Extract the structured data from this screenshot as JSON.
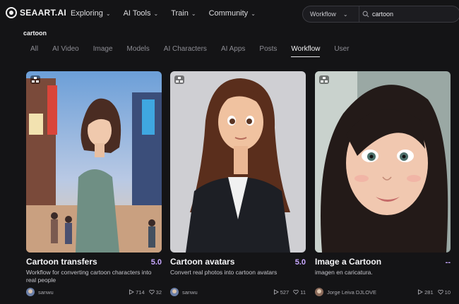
{
  "logo": {
    "text": "SEAART.AI"
  },
  "nav": [
    {
      "label": "Exploring"
    },
    {
      "label": "AI Tools"
    },
    {
      "label": "Train"
    },
    {
      "label": "Community"
    }
  ],
  "search": {
    "scope": "Workflow",
    "value": "cartoon",
    "placeholder": ""
  },
  "query_label": "cartoon",
  "tabs": [
    {
      "label": "All"
    },
    {
      "label": "AI Video"
    },
    {
      "label": "Image"
    },
    {
      "label": "Models"
    },
    {
      "label": "AI Characters"
    },
    {
      "label": "AI Apps"
    },
    {
      "label": "Posts"
    },
    {
      "label": "Workflow",
      "active": true
    },
    {
      "label": "User"
    }
  ],
  "cards": [
    {
      "title": "Cartoon transfers",
      "score": "5.0",
      "description": "Workflow for converting cartoon characters into real people",
      "author": "sanwu",
      "runs": "714",
      "likes": "32"
    },
    {
      "title": "Cartoon avatars",
      "score": "5.0",
      "description": "Convert real photos into cartoon avatars",
      "author": "sanwu",
      "runs": "527",
      "likes": "11"
    },
    {
      "title": "Image a Cartoon",
      "score": "--",
      "description": "imagen en caricatura.",
      "author": "Jorge Leiva DJLOVE",
      "runs": "281",
      "likes": "10"
    }
  ],
  "colors": {
    "background": "#141416",
    "accent": "#c8a8ff",
    "tab_active": "#f3f3f5"
  }
}
